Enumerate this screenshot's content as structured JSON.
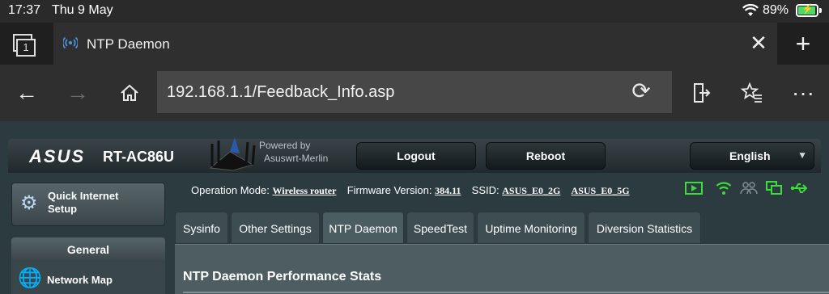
{
  "status_bar": {
    "time": "17:37",
    "date": "Thu 9 May",
    "battery": "89%",
    "wifi_icon": "wifi-icon"
  },
  "tabs": {
    "count": "1",
    "active_title": "NTP Daemon"
  },
  "address_bar": {
    "url": "192.168.1.1/Feedback_Info.asp"
  },
  "router": {
    "brand": "ASUS",
    "model": "RT-AC86U",
    "powered_by_line1": "Powered by",
    "powered_by_line2": "Asuswrt-Merlin",
    "logout_label": "Logout",
    "reboot_label": "Reboot",
    "language": "English",
    "quick_setup_line1": "Quick Internet",
    "quick_setup_line2": "Setup",
    "general_label": "General",
    "network_map_label": "Network Map",
    "opmode_label": "Operation Mode:",
    "opmode_value": "Wireless router",
    "fw_label": "Firmware Version:",
    "fw_value": "384.11",
    "ssid_label": "SSID:",
    "ssid_1": "ASUS_E0_2G",
    "ssid_2": "ASUS_E0_5G",
    "subtabs": [
      "Sysinfo",
      "Other Settings",
      "NTP Daemon",
      "SpeedTest",
      "Uptime Monitoring",
      "Diversion Statistics"
    ],
    "content_heading": "NTP Daemon Performance Stats"
  },
  "colors": {
    "status_green": "#3ddc3d",
    "page_bg": "#2c3b40",
    "battery_green": "#4cd964"
  }
}
